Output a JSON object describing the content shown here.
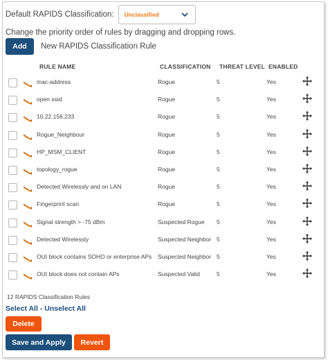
{
  "default_classification": {
    "label": "Default RAPIDS Classification:",
    "value": "Unclassified"
  },
  "help_text": "Change the priority order of rules by dragging and dropping rows.",
  "add": {
    "button_label": "Add",
    "description": "New RAPIDS Classification Rule"
  },
  "table": {
    "headers": {
      "rule_name": "RULE NAME",
      "classification": "CLASSIFICATION",
      "threat_level": "THREAT LEVEL",
      "enabled": "ENABLED"
    },
    "rows": [
      {
        "name": "mac-address",
        "classification": "Rogue",
        "threat": "5",
        "enabled": "Yes"
      },
      {
        "name": "open ssid",
        "classification": "Rogue",
        "threat": "5",
        "enabled": "Yes"
      },
      {
        "name": "10.22.156.233",
        "classification": "Rogue",
        "threat": "5",
        "enabled": "Yes"
      },
      {
        "name": "Rogue_Neighbour",
        "classification": "Rogue",
        "threat": "5",
        "enabled": "Yes"
      },
      {
        "name": "HP_MSM_CLIENT",
        "classification": "Rogue",
        "threat": "5",
        "enabled": "Yes"
      },
      {
        "name": "topology_rogue",
        "classification": "Rogue",
        "threat": "5",
        "enabled": "Yes"
      },
      {
        "name": "Detected Wirelessly and on LAN",
        "classification": "Rogue",
        "threat": "5",
        "enabled": "Yes"
      },
      {
        "name": "Fingerprint scan",
        "classification": "Rogue",
        "threat": "5",
        "enabled": "Yes"
      },
      {
        "name": "Signal strength > -75 dBm",
        "classification": "Suspected Rogue",
        "threat": "5",
        "enabled": "Yes"
      },
      {
        "name": "Detected Wirelessly",
        "classification": "Suspected Neighbor",
        "threat": "5",
        "enabled": "Yes"
      },
      {
        "name": "OUI block contains SOHO or enterprise APs",
        "classification": "Suspected Neighbor",
        "threat": "5",
        "enabled": "Yes"
      },
      {
        "name": "OUI block does not contain APs",
        "classification": "Suspected Valid",
        "threat": "5",
        "enabled": "Yes"
      }
    ]
  },
  "rule_count": "12 RAPIDS Classification Rules",
  "select_all": "Select All",
  "separator": " - ",
  "unselect_all": "Unselect All",
  "buttons": {
    "delete": "Delete",
    "save_apply": "Save and Apply",
    "revert": "Revert"
  },
  "icons": {
    "select_chevron": "chevron-down-icon",
    "rule": "rule-tag-icon",
    "drag": "drag-move-icon"
  },
  "colors": {
    "primary_blue": "#1d4f7c",
    "accent_orange": "#f0550d",
    "unclassified_text": "#f07b18"
  }
}
